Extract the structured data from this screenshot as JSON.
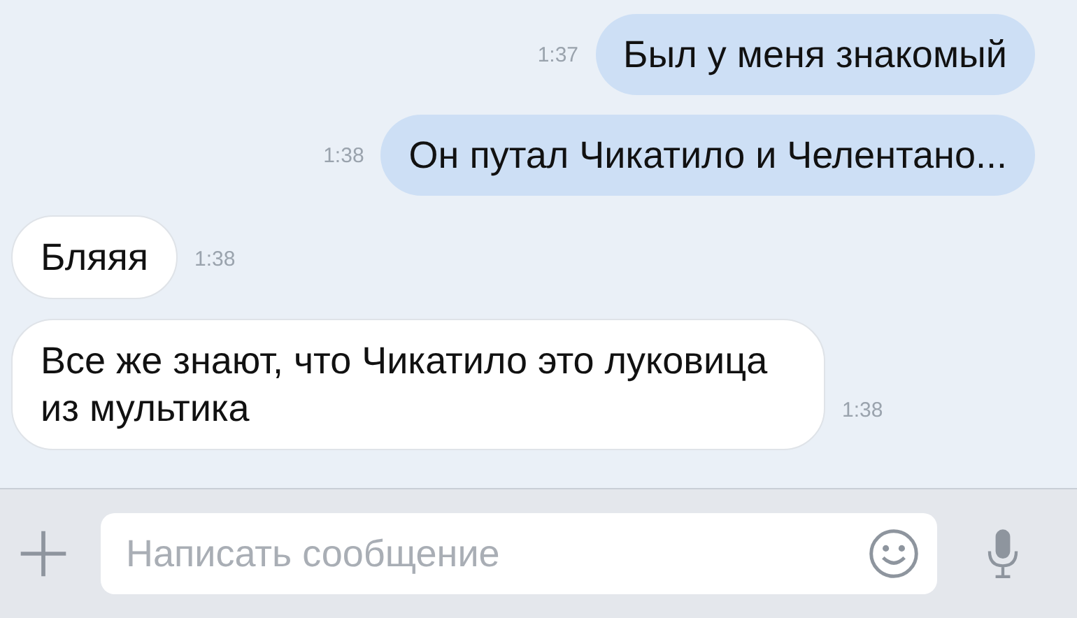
{
  "messages": [
    {
      "kind": "outgoing",
      "text": "Был у меня знакомый",
      "time": "1:37"
    },
    {
      "kind": "outgoing",
      "text": "Он путал Чикатило и Челентано...",
      "time": "1:38"
    },
    {
      "kind": "incoming",
      "text": "Бляяя",
      "time": "1:38"
    },
    {
      "kind": "incoming",
      "text": "Все же знают, что Чикатило это луковица из мультика",
      "time": "1:38"
    }
  ],
  "composer": {
    "placeholder": "Написать сообщение"
  }
}
